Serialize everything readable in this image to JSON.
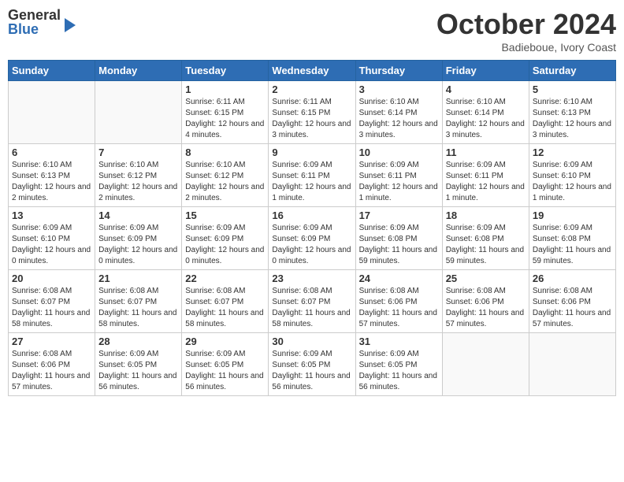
{
  "header": {
    "logo_general": "General",
    "logo_blue": "Blue",
    "month": "October 2024",
    "location": "Badieboue, Ivory Coast"
  },
  "days_of_week": [
    "Sunday",
    "Monday",
    "Tuesday",
    "Wednesday",
    "Thursday",
    "Friday",
    "Saturday"
  ],
  "weeks": [
    [
      {
        "day": "",
        "info": ""
      },
      {
        "day": "",
        "info": ""
      },
      {
        "day": "1",
        "info": "Sunrise: 6:11 AM\nSunset: 6:15 PM\nDaylight: 12 hours and 4 minutes."
      },
      {
        "day": "2",
        "info": "Sunrise: 6:11 AM\nSunset: 6:15 PM\nDaylight: 12 hours and 3 minutes."
      },
      {
        "day": "3",
        "info": "Sunrise: 6:10 AM\nSunset: 6:14 PM\nDaylight: 12 hours and 3 minutes."
      },
      {
        "day": "4",
        "info": "Sunrise: 6:10 AM\nSunset: 6:14 PM\nDaylight: 12 hours and 3 minutes."
      },
      {
        "day": "5",
        "info": "Sunrise: 6:10 AM\nSunset: 6:13 PM\nDaylight: 12 hours and 3 minutes."
      }
    ],
    [
      {
        "day": "6",
        "info": "Sunrise: 6:10 AM\nSunset: 6:13 PM\nDaylight: 12 hours and 2 minutes."
      },
      {
        "day": "7",
        "info": "Sunrise: 6:10 AM\nSunset: 6:12 PM\nDaylight: 12 hours and 2 minutes."
      },
      {
        "day": "8",
        "info": "Sunrise: 6:10 AM\nSunset: 6:12 PM\nDaylight: 12 hours and 2 minutes."
      },
      {
        "day": "9",
        "info": "Sunrise: 6:09 AM\nSunset: 6:11 PM\nDaylight: 12 hours and 1 minute."
      },
      {
        "day": "10",
        "info": "Sunrise: 6:09 AM\nSunset: 6:11 PM\nDaylight: 12 hours and 1 minute."
      },
      {
        "day": "11",
        "info": "Sunrise: 6:09 AM\nSunset: 6:11 PM\nDaylight: 12 hours and 1 minute."
      },
      {
        "day": "12",
        "info": "Sunrise: 6:09 AM\nSunset: 6:10 PM\nDaylight: 12 hours and 1 minute."
      }
    ],
    [
      {
        "day": "13",
        "info": "Sunrise: 6:09 AM\nSunset: 6:10 PM\nDaylight: 12 hours and 0 minutes."
      },
      {
        "day": "14",
        "info": "Sunrise: 6:09 AM\nSunset: 6:09 PM\nDaylight: 12 hours and 0 minutes."
      },
      {
        "day": "15",
        "info": "Sunrise: 6:09 AM\nSunset: 6:09 PM\nDaylight: 12 hours and 0 minutes."
      },
      {
        "day": "16",
        "info": "Sunrise: 6:09 AM\nSunset: 6:09 PM\nDaylight: 12 hours and 0 minutes."
      },
      {
        "day": "17",
        "info": "Sunrise: 6:09 AM\nSunset: 6:08 PM\nDaylight: 11 hours and 59 minutes."
      },
      {
        "day": "18",
        "info": "Sunrise: 6:09 AM\nSunset: 6:08 PM\nDaylight: 11 hours and 59 minutes."
      },
      {
        "day": "19",
        "info": "Sunrise: 6:09 AM\nSunset: 6:08 PM\nDaylight: 11 hours and 59 minutes."
      }
    ],
    [
      {
        "day": "20",
        "info": "Sunrise: 6:08 AM\nSunset: 6:07 PM\nDaylight: 11 hours and 58 minutes."
      },
      {
        "day": "21",
        "info": "Sunrise: 6:08 AM\nSunset: 6:07 PM\nDaylight: 11 hours and 58 minutes."
      },
      {
        "day": "22",
        "info": "Sunrise: 6:08 AM\nSunset: 6:07 PM\nDaylight: 11 hours and 58 minutes."
      },
      {
        "day": "23",
        "info": "Sunrise: 6:08 AM\nSunset: 6:07 PM\nDaylight: 11 hours and 58 minutes."
      },
      {
        "day": "24",
        "info": "Sunrise: 6:08 AM\nSunset: 6:06 PM\nDaylight: 11 hours and 57 minutes."
      },
      {
        "day": "25",
        "info": "Sunrise: 6:08 AM\nSunset: 6:06 PM\nDaylight: 11 hours and 57 minutes."
      },
      {
        "day": "26",
        "info": "Sunrise: 6:08 AM\nSunset: 6:06 PM\nDaylight: 11 hours and 57 minutes."
      }
    ],
    [
      {
        "day": "27",
        "info": "Sunrise: 6:08 AM\nSunset: 6:06 PM\nDaylight: 11 hours and 57 minutes."
      },
      {
        "day": "28",
        "info": "Sunrise: 6:09 AM\nSunset: 6:05 PM\nDaylight: 11 hours and 56 minutes."
      },
      {
        "day": "29",
        "info": "Sunrise: 6:09 AM\nSunset: 6:05 PM\nDaylight: 11 hours and 56 minutes."
      },
      {
        "day": "30",
        "info": "Sunrise: 6:09 AM\nSunset: 6:05 PM\nDaylight: 11 hours and 56 minutes."
      },
      {
        "day": "31",
        "info": "Sunrise: 6:09 AM\nSunset: 6:05 PM\nDaylight: 11 hours and 56 minutes."
      },
      {
        "day": "",
        "info": ""
      },
      {
        "day": "",
        "info": ""
      }
    ]
  ]
}
